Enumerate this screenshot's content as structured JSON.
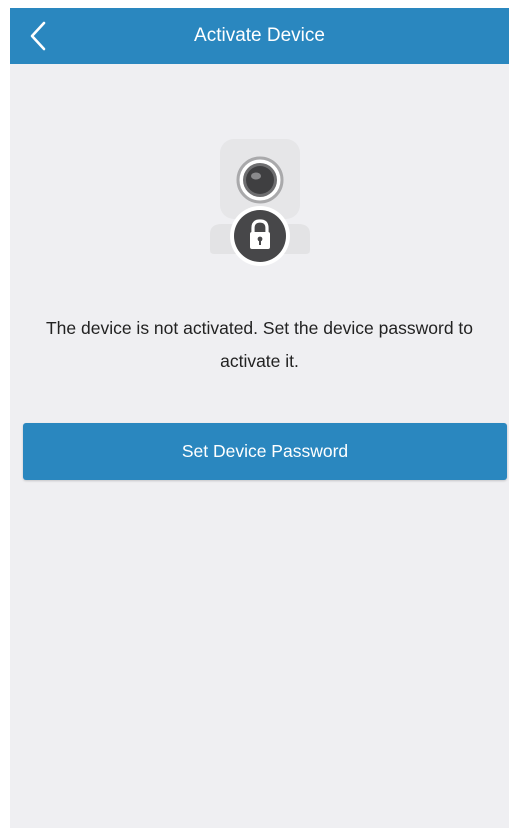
{
  "header": {
    "title": "Activate Device",
    "back_icon": "chevron-left-icon"
  },
  "illustration": {
    "device_icon": "camera-icon",
    "lock_icon": "lock-icon"
  },
  "main": {
    "message": "The device is not activated. Set the device password to activate it.",
    "primary_button_label": "Set Device Password"
  },
  "colors": {
    "accent": "#2a87bf",
    "background": "#efeff2",
    "text": "#222222"
  }
}
